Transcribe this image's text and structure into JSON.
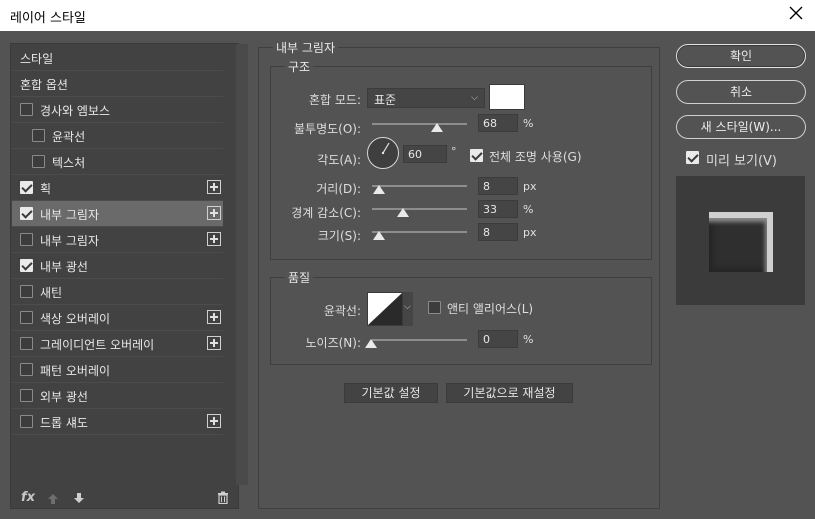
{
  "window": {
    "title": "레이어 스타일",
    "close_icon": "close-icon"
  },
  "styles": {
    "items": [
      {
        "label": "스타일",
        "checkbox": false,
        "checked": false,
        "plus": false,
        "selected": false,
        "indent": false
      },
      {
        "label": "혼합 옵션",
        "checkbox": false,
        "checked": false,
        "plus": false,
        "selected": false,
        "indent": false
      },
      {
        "label": "경사와 엠보스",
        "checkbox": true,
        "checked": false,
        "plus": false,
        "selected": false,
        "indent": false
      },
      {
        "label": "윤곽선",
        "checkbox": true,
        "checked": false,
        "plus": false,
        "selected": false,
        "indent": true
      },
      {
        "label": "텍스처",
        "checkbox": true,
        "checked": false,
        "plus": false,
        "selected": false,
        "indent": true
      },
      {
        "label": "획",
        "checkbox": true,
        "checked": true,
        "plus": true,
        "selected": false,
        "indent": false
      },
      {
        "label": "내부 그림자",
        "checkbox": true,
        "checked": true,
        "plus": true,
        "selected": true,
        "indent": false
      },
      {
        "label": "내부 그림자",
        "checkbox": true,
        "checked": false,
        "plus": true,
        "selected": false,
        "indent": false
      },
      {
        "label": "내부 광선",
        "checkbox": true,
        "checked": true,
        "plus": false,
        "selected": false,
        "indent": false
      },
      {
        "label": "새틴",
        "checkbox": true,
        "checked": false,
        "plus": false,
        "selected": false,
        "indent": false
      },
      {
        "label": "색상 오버레이",
        "checkbox": true,
        "checked": false,
        "plus": true,
        "selected": false,
        "indent": false
      },
      {
        "label": "그레이디언트 오버레이",
        "checkbox": true,
        "checked": false,
        "plus": true,
        "selected": false,
        "indent": false
      },
      {
        "label": "패턴 오버레이",
        "checkbox": true,
        "checked": false,
        "plus": false,
        "selected": false,
        "indent": false
      },
      {
        "label": "외부 광선",
        "checkbox": true,
        "checked": false,
        "plus": false,
        "selected": false,
        "indent": false
      },
      {
        "label": "드롭 섀도",
        "checkbox": true,
        "checked": false,
        "plus": true,
        "selected": false,
        "indent": false
      }
    ],
    "bottom": {
      "fx": "fx",
      "up_icon": "arrow-up-icon",
      "down_icon": "arrow-down-icon",
      "trash_icon": "trash-icon"
    }
  },
  "panel": {
    "title": "내부 그림자",
    "structure": {
      "legend": "구조",
      "blend_mode_label": "혼합 모드:",
      "blend_mode_value": "표준",
      "blend_color": "#ffffff",
      "opacity_label": "불투명도(O):",
      "opacity_value": "68",
      "opacity_unit": "%",
      "opacity_level": 0.68,
      "angle_label": "각도(A):",
      "angle_value": "60",
      "angle_unit": "°",
      "global_light_label": "전체 조명 사용(G)",
      "global_light_checked": true,
      "distance_label": "거리(D):",
      "distance_value": "8",
      "distance_unit": "px",
      "choke_label": "경계 감소(C):",
      "choke_value": "33",
      "choke_unit": "%",
      "size_label": "크기(S):",
      "size_value": "8",
      "size_unit": "px"
    },
    "quality": {
      "legend": "품질",
      "contour_label": "윤곽선:",
      "antialias_label": "앤티 앨리어스(L)",
      "antialias_checked": false,
      "noise_label": "노이즈(N):",
      "noise_value": "0",
      "noise_unit": "%"
    },
    "make_default": "기본값 설정",
    "reset_default": "기본값으로 재설정"
  },
  "actions": {
    "ok": "확인",
    "cancel": "취소",
    "new_style": "새 스타일(W)...",
    "preview_label": "미리 보기(V)",
    "preview_checked": true
  }
}
